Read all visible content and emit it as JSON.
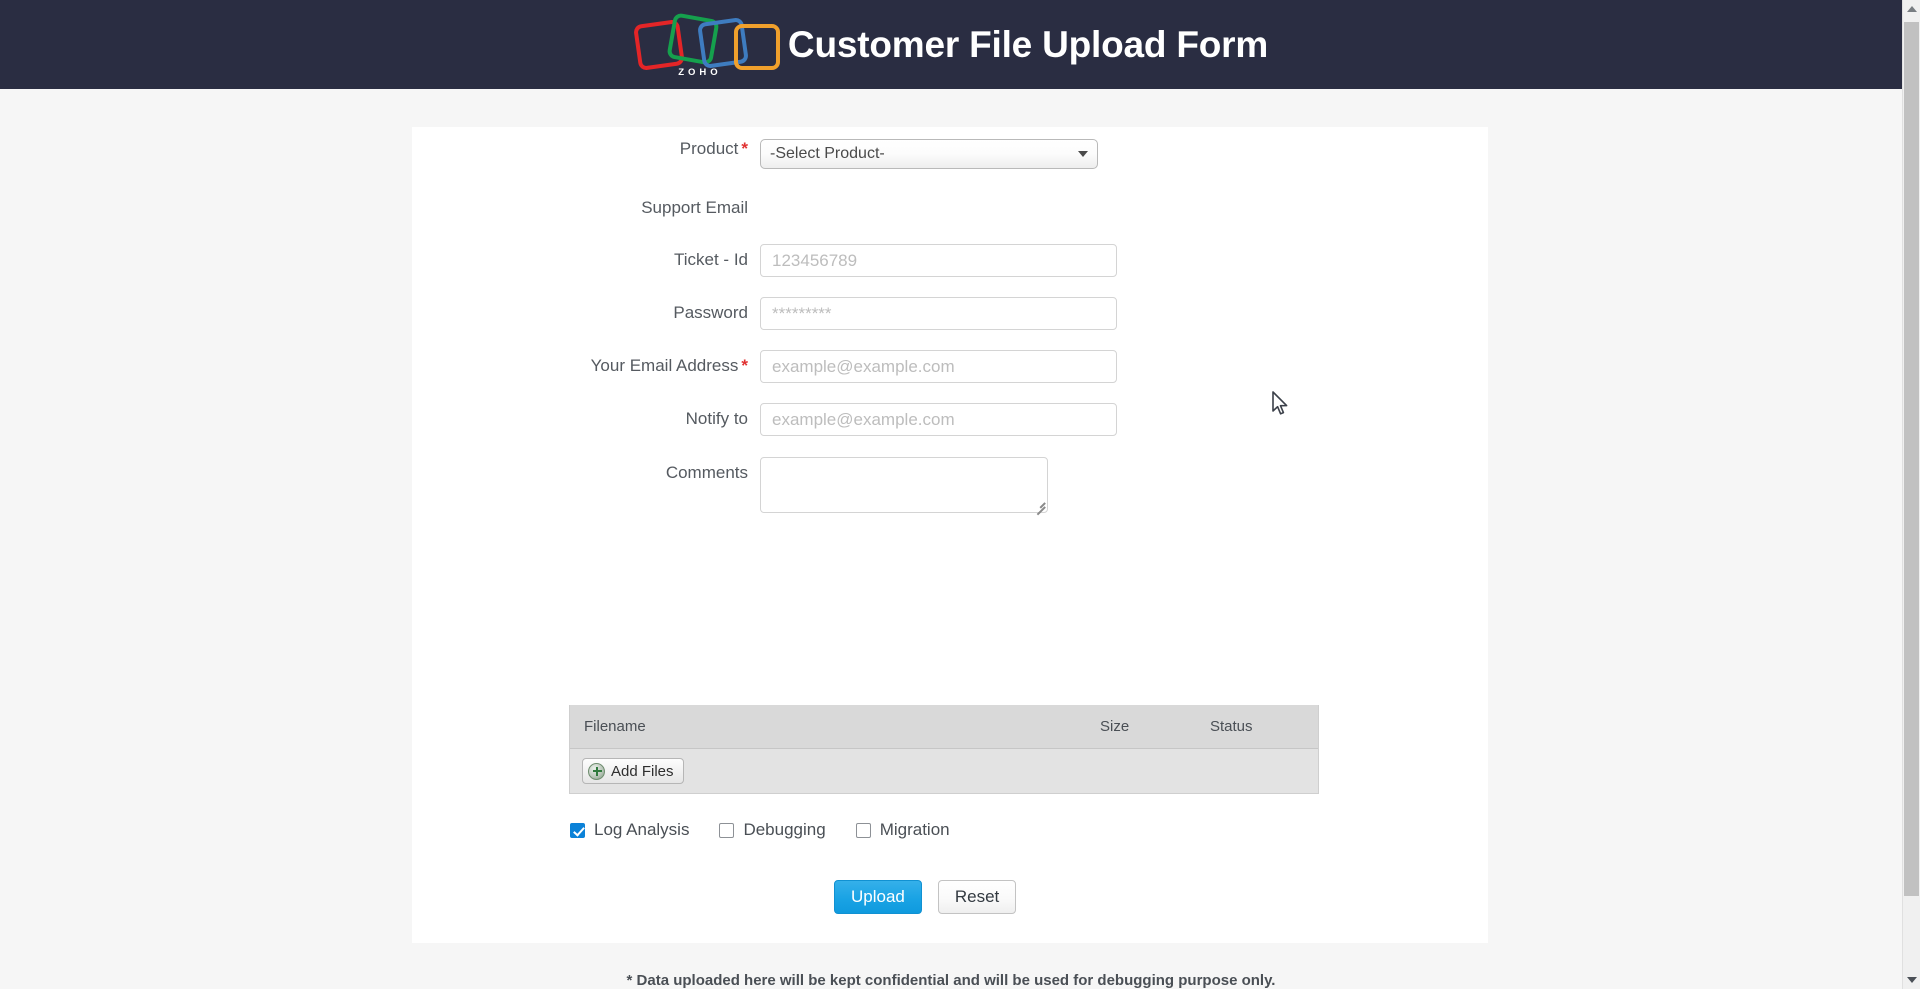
{
  "header": {
    "title": "Customer File Upload Form",
    "logo_wordmark": "ZOHO",
    "background_color": "#2a2d42"
  },
  "form": {
    "fields": [
      {
        "label": "Product",
        "required": true,
        "type": "select",
        "value": "-Select Product-"
      },
      {
        "label": "Support Email",
        "required": false,
        "type": "static",
        "value": ""
      },
      {
        "label": "Ticket - Id",
        "required": false,
        "type": "text",
        "value": "",
        "placeholder": "123456789"
      },
      {
        "label": "Password",
        "required": false,
        "type": "password",
        "value": "",
        "placeholder": "*********"
      },
      {
        "label": "Your Email Address",
        "required": true,
        "type": "email",
        "value": "",
        "placeholder": "example@example.com"
      },
      {
        "label": "Notify to",
        "required": false,
        "type": "email",
        "value": "",
        "placeholder": "example@example.com"
      },
      {
        "label": "Comments",
        "required": false,
        "type": "textarea",
        "value": "",
        "placeholder": ""
      }
    ],
    "required_marker": "*"
  },
  "file_table": {
    "columns": [
      "Filename",
      "Size",
      "Status"
    ],
    "rows": [],
    "add_files_label": "Add Files"
  },
  "options": [
    {
      "label": "Log Analysis",
      "checked": true
    },
    {
      "label": "Debugging",
      "checked": false
    },
    {
      "label": "Migration",
      "checked": false
    }
  ],
  "actions": {
    "upload_label": "Upload",
    "reset_label": "Reset",
    "upload_color": "#1aa3e4"
  },
  "footer": {
    "note": "* Data uploaded here will be kept confidential and will be used for debugging purpose only."
  }
}
